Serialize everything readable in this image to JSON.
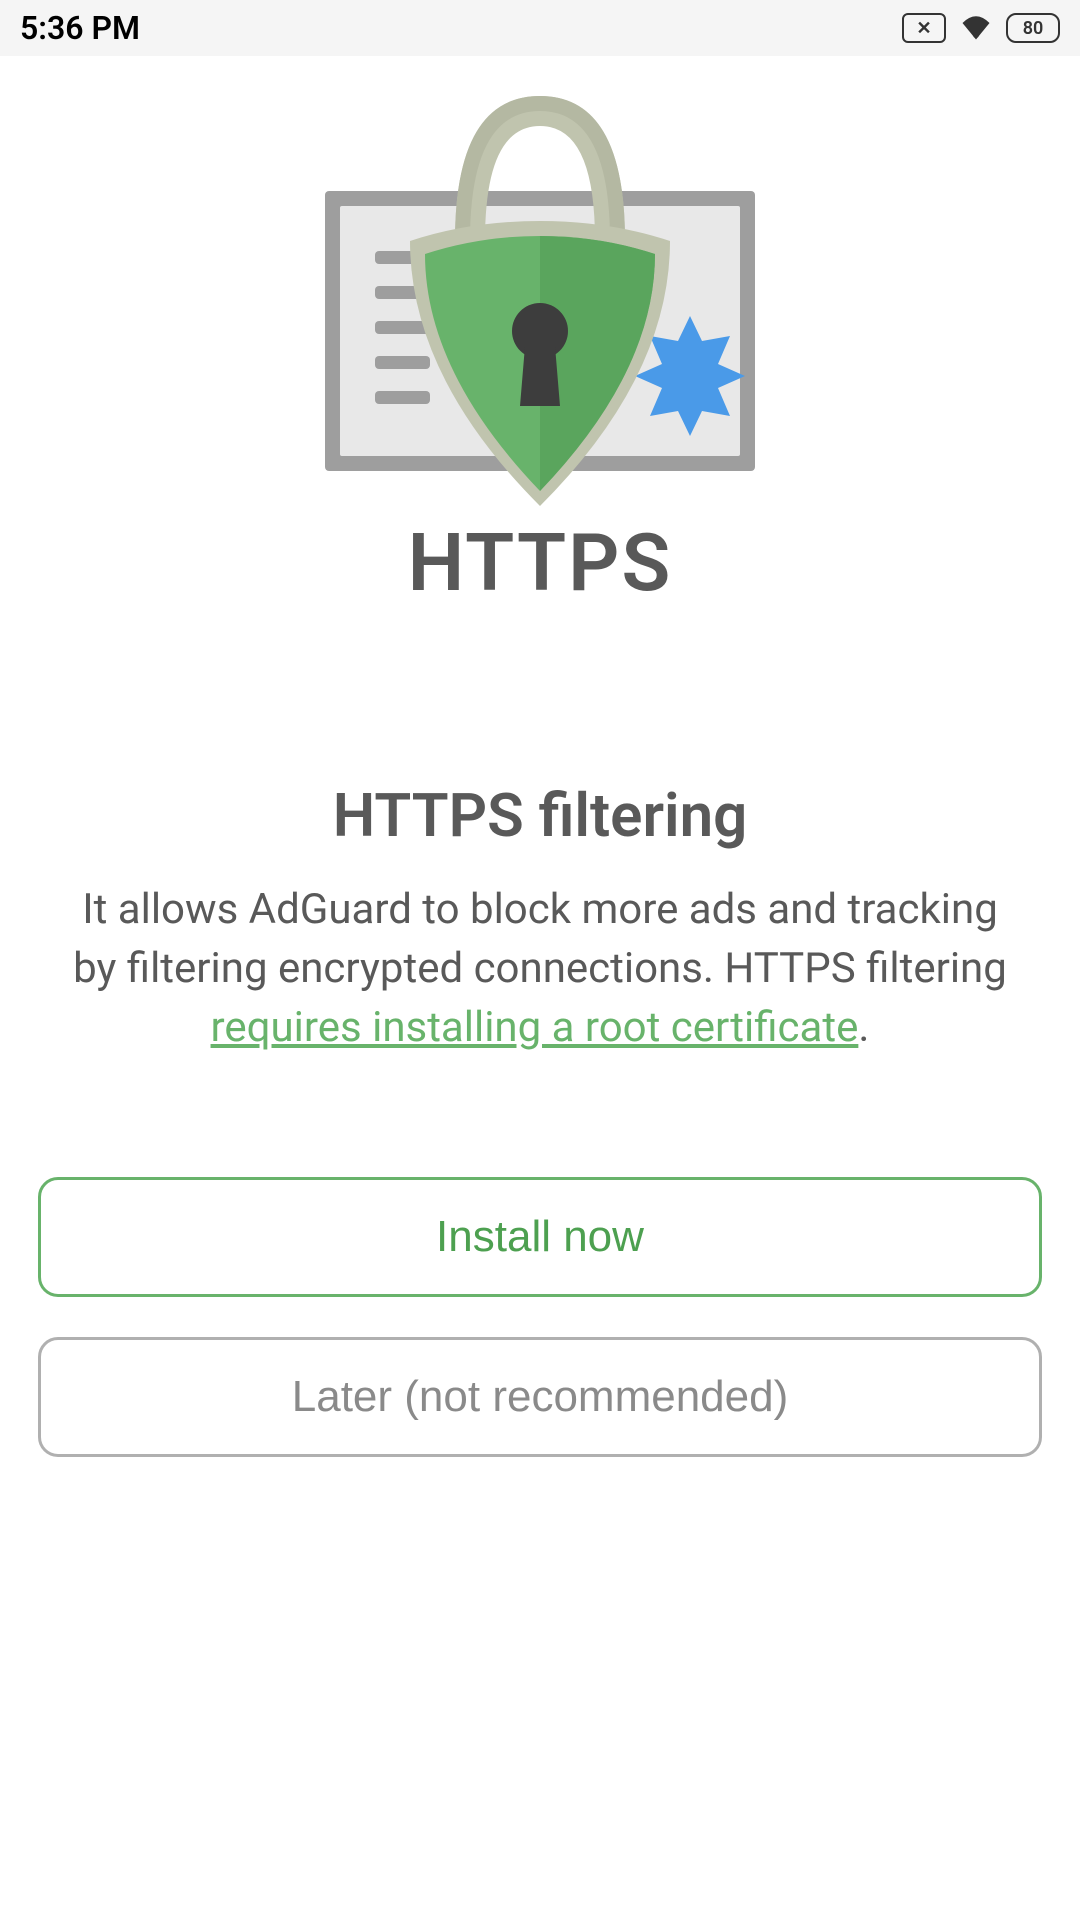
{
  "statusBar": {
    "time": "5:36 PM",
    "battery": "80"
  },
  "illustration": {
    "label": "HTTPS"
  },
  "content": {
    "title": "HTTPS filtering",
    "descriptionPart1": "It allows AdGuard to block more ads and tracking by filtering encrypted connections. HTTPS filtering ",
    "linkText": "requires installing a root certificate",
    "descriptionPart2": "."
  },
  "buttons": {
    "primary": "Install now",
    "secondary": "Later (not recommended)"
  }
}
